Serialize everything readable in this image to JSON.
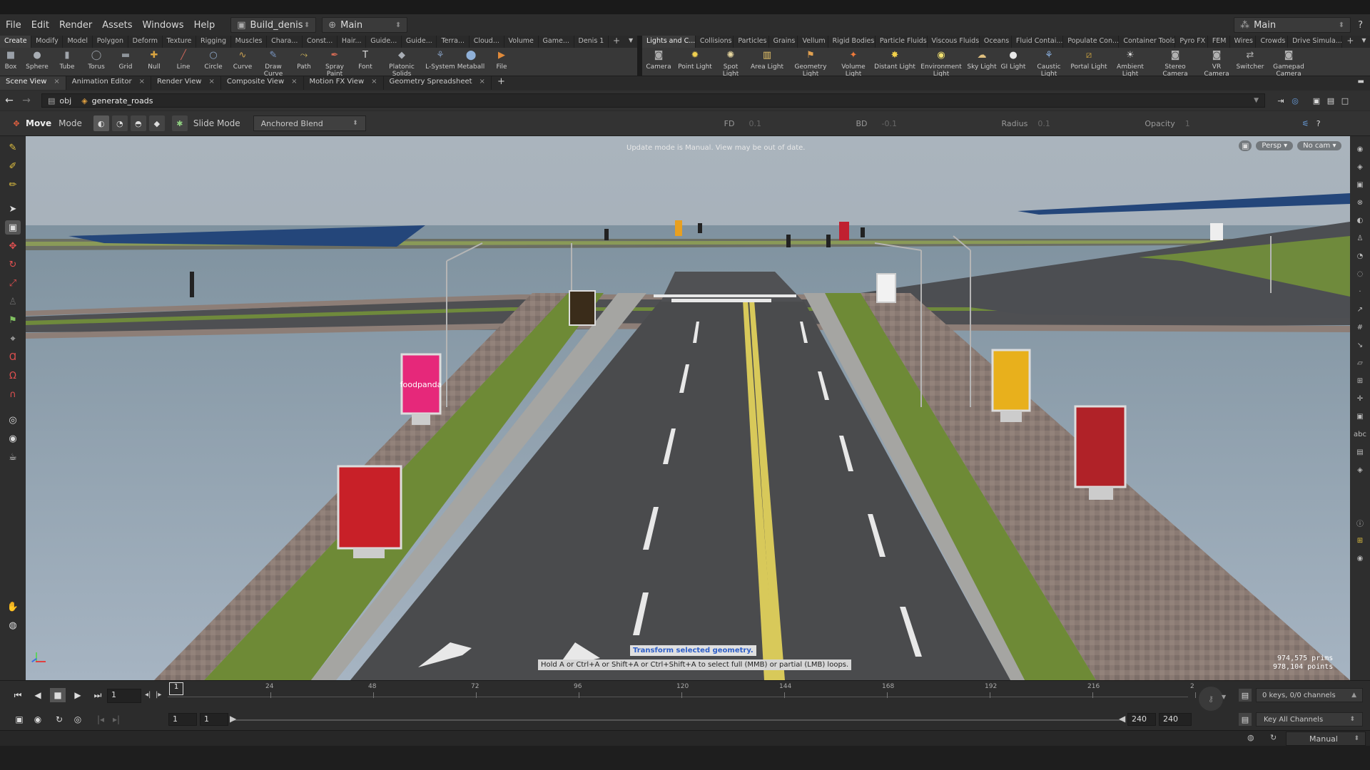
{
  "menu": {
    "items": [
      "File",
      "Edit",
      "Render",
      "Assets",
      "Windows",
      "Help"
    ],
    "desktop": "Build_denis",
    "context": "Main",
    "right_desktop": "Main"
  },
  "shelf_tabs_left": [
    "Create",
    "Modify",
    "Model",
    "Polygon",
    "Deform",
    "Texture",
    "Rigging",
    "Muscles",
    "Chara...",
    "Const...",
    "Hair...",
    "Guide...",
    "Guide...",
    "Terra...",
    "Cloud...",
    "Volume",
    "Game...",
    "Denis 1"
  ],
  "shelf_tabs_right": [
    "Lights and C...",
    "Collisions",
    "Particles",
    "Grains",
    "Vellum",
    "Rigid Bodies",
    "Particle Fluids",
    "Viscous Fluids",
    "Oceans",
    "Fluid Contai...",
    "Populate Con...",
    "Container Tools",
    "Pyro FX",
    "FEM",
    "Wires",
    "Crowds",
    "Drive Simula..."
  ],
  "tools_left": [
    {
      "label": "Box",
      "icon": "box-icon",
      "color": "#9aa0a8"
    },
    {
      "label": "Sphere",
      "icon": "sphere-icon",
      "color": "#a8adb3"
    },
    {
      "label": "Tube",
      "icon": "tube-icon",
      "color": "#a0a5ab"
    },
    {
      "label": "Torus",
      "icon": "torus-icon",
      "color": "#9aa0a8"
    },
    {
      "label": "Grid",
      "icon": "grid-icon",
      "color": "#8e949a"
    },
    {
      "label": "Null",
      "icon": "null-icon",
      "color": "#d9a441"
    },
    {
      "label": "Line",
      "icon": "line-icon",
      "color": "#c9665a"
    },
    {
      "label": "Circle",
      "icon": "circle-icon",
      "color": "#8fa8c8"
    },
    {
      "label": "Curve",
      "icon": "curve-icon",
      "color": "#c8a052"
    },
    {
      "label": "Draw Curve",
      "icon": "draw-curve-icon",
      "color": "#7b98c6"
    },
    {
      "label": "Path",
      "icon": "path-icon",
      "color": "#c9b15a"
    },
    {
      "label": "Spray Paint",
      "icon": "spray-paint-icon",
      "color": "#d26a54"
    },
    {
      "label": "Font",
      "icon": "font-icon",
      "color": "#d8d8d8"
    },
    {
      "label": "Platonic Solids",
      "icon": "platonic-solids-icon",
      "color": "#a9aeb5"
    },
    {
      "label": "L-System",
      "icon": "l-system-icon",
      "color": "#7e95b5"
    },
    {
      "label": "Metaball",
      "icon": "metaball-icon",
      "color": "#8fb0d8"
    },
    {
      "label": "File",
      "icon": "file-icon",
      "color": "#e08a3a"
    }
  ],
  "tools_right": [
    {
      "label": "Camera",
      "icon": "camera-icon",
      "color": "#a9a9a9"
    },
    {
      "label": "Point Light",
      "icon": "point-light-icon",
      "color": "#f0d050"
    },
    {
      "label": "Spot Light",
      "icon": "spot-light-icon",
      "color": "#e8d8a0"
    },
    {
      "label": "Area Light",
      "icon": "area-light-icon",
      "color": "#e9c66a"
    },
    {
      "label": "Geometry Light",
      "icon": "geometry-light-icon",
      "color": "#e0a050"
    },
    {
      "label": "Volume Light",
      "icon": "volume-light-icon",
      "color": "#f07a3a"
    },
    {
      "label": "Distant Light",
      "icon": "distant-light-icon",
      "color": "#f2d04a"
    },
    {
      "label": "Environment Light",
      "icon": "environment-light-icon",
      "color": "#f0e070"
    },
    {
      "label": "Sky Light",
      "icon": "sky-light-icon",
      "color": "#e0c080"
    },
    {
      "label": "GI Light",
      "icon": "gi-light-icon",
      "color": "#e9e9e9"
    },
    {
      "label": "Caustic Light",
      "icon": "caustic-light-icon",
      "color": "#8ab0e0"
    },
    {
      "label": "Portal Light",
      "icon": "portal-light-icon",
      "color": "#c8a040"
    },
    {
      "label": "Ambient Light",
      "icon": "ambient-light-icon",
      "color": "#d8d8d8"
    },
    {
      "label": "Stereo Camera",
      "icon": "stereo-camera-icon",
      "color": "#b0b0b0"
    },
    {
      "label": "VR Camera",
      "icon": "vr-camera-icon",
      "color": "#b0b0b0"
    },
    {
      "label": "Switcher",
      "icon": "switcher-icon",
      "color": "#b0b0b0"
    },
    {
      "label": "Gamepad Camera",
      "icon": "gamepad-camera-icon",
      "color": "#b0b0b0"
    }
  ],
  "panel_tabs": [
    "Scene View",
    "Animation Editor",
    "Render View",
    "Composite View",
    "Motion FX View",
    "Geometry Spreadsheet"
  ],
  "path": {
    "root": "obj",
    "node": "generate_roads"
  },
  "tool_options": {
    "tool": "Move",
    "mode_label": "Mode",
    "slide_mode_label": "Slide Mode",
    "blend": "Anchored Blend",
    "fd_label": "FD",
    "fd_value": "0.1",
    "bd_label": "BD",
    "bd_value": "-0.1",
    "radius_label": "Radius",
    "radius_value": "0.1",
    "opacity_label": "Opacity",
    "opacity_value": "1"
  },
  "viewport": {
    "update_msg": "Update mode is Manual. View may be out of date.",
    "persp": "Persp",
    "cam": "No cam",
    "hint_title": "Transform selected geometry.",
    "hint_body": "Hold A or Ctrl+A or Shift+A or Ctrl+Shift+A to select full (MMB) or partial (LMB) loops.",
    "prims": "974,575  prims",
    "points": "978,104 points",
    "billboard_text": "foodpanda"
  },
  "timeline": {
    "frame": "1",
    "current_marker": "1",
    "ticks": [
      "24",
      "48",
      "72",
      "96",
      "120",
      "144",
      "168",
      "192",
      "216",
      "2"
    ],
    "start": "1",
    "start2": "1",
    "end": "240",
    "end2": "240",
    "keys": "0 keys, 0/0 channels",
    "key_all": "Key All Channels"
  },
  "status": {
    "update_mode": "Manual"
  }
}
